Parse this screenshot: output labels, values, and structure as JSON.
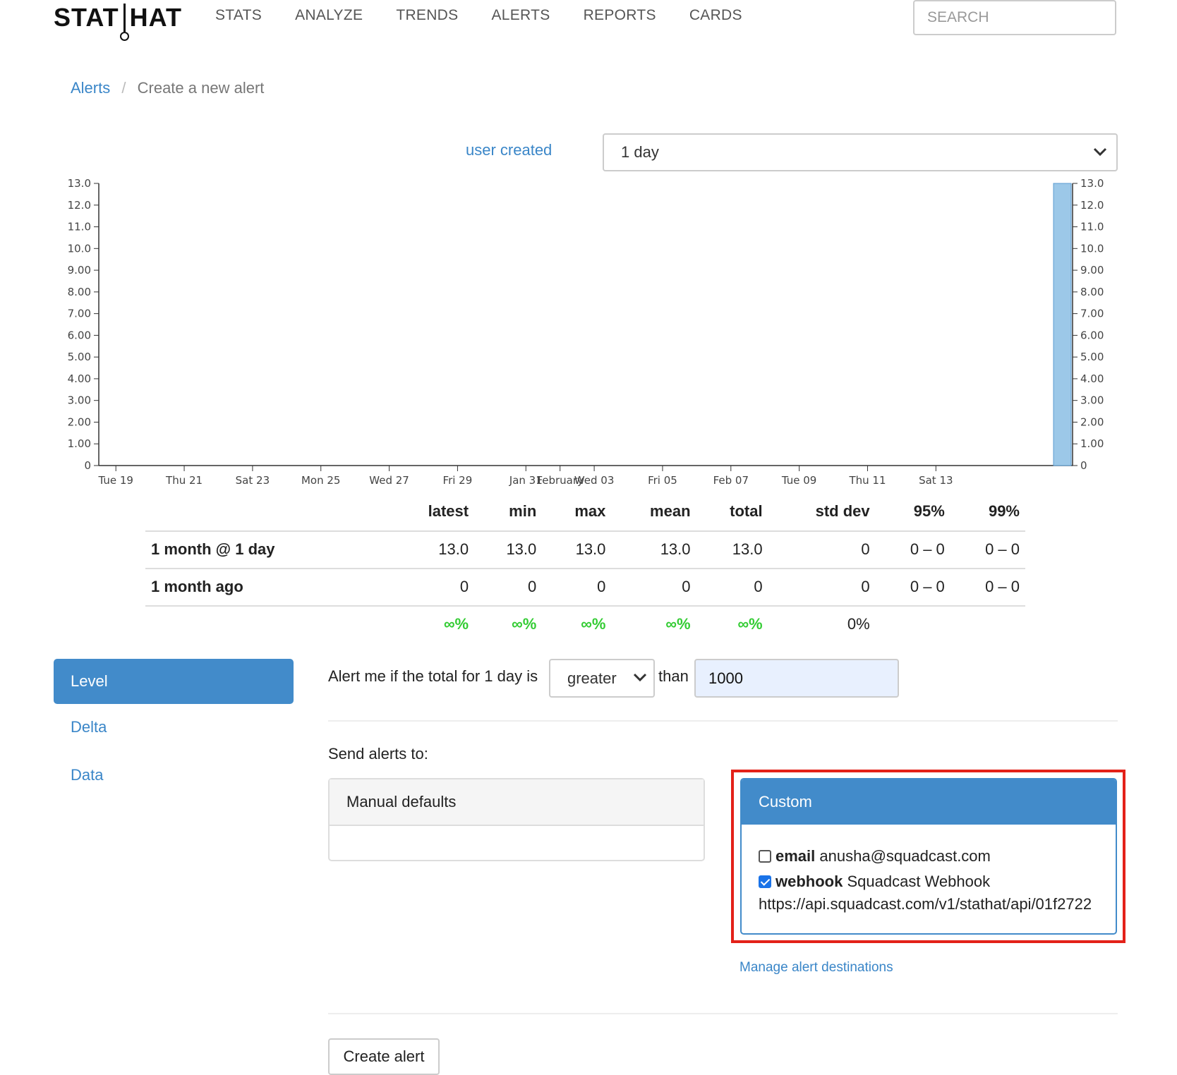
{
  "header": {
    "logo_left": "STAT",
    "logo_right": "HAT",
    "nav": [
      "STATS",
      "ANALYZE",
      "TRENDS",
      "ALERTS",
      "REPORTS",
      "CARDS"
    ],
    "search_placeholder": "SEARCH"
  },
  "breadcrumb": {
    "parent": "Alerts",
    "sep": "/",
    "current": "Create a new alert"
  },
  "stat_name": "user created",
  "range_select": "1 day",
  "chart_data": {
    "type": "bar",
    "y_ticks": [
      "0",
      "1.00",
      "2.00",
      "3.00",
      "4.00",
      "5.00",
      "6.00",
      "7.00",
      "8.00",
      "9.00",
      "10.0",
      "11.0",
      "12.0",
      "13.0"
    ],
    "ylim": [
      0,
      13
    ],
    "x_ticks": [
      "Tue 19",
      "Thu 21",
      "Sat 23",
      "Mon 25",
      "Wed 27",
      "Fri 29",
      "Jan 31",
      "February",
      "Wed 03",
      "Fri 05",
      "Feb 07",
      "Tue 09",
      "Thu 11",
      "Sat 13"
    ],
    "series": [
      {
        "x": "Feb 14",
        "y": 13.0
      }
    ],
    "bar_color": "#9cc8e8"
  },
  "stats_table": {
    "headers": [
      "",
      "latest",
      "min",
      "max",
      "mean",
      "total",
      "std dev",
      "95%",
      "99%"
    ],
    "rows": [
      [
        "1 month @ 1 day",
        "13.0",
        "13.0",
        "13.0",
        "13.0",
        "13.0",
        "0",
        "0 – 0",
        "0 – 0"
      ],
      [
        "1 month ago",
        "0",
        "0",
        "0",
        "0",
        "0",
        "0",
        "0 – 0",
        "0 – 0"
      ]
    ],
    "pct_row": [
      "",
      "∞%",
      "∞%",
      "∞%",
      "∞%",
      "∞%",
      "0%",
      "",
      ""
    ],
    "pct_color": "#3c3"
  },
  "tabs": {
    "level": "Level",
    "delta": "Delta",
    "data": "Data"
  },
  "rule": {
    "prefix": "Alert me if the total for 1 day is",
    "comparison": "greater",
    "than": "than",
    "threshold": "1000"
  },
  "send_to_label": "Send alerts to:",
  "manual_defaults": "Manual defaults",
  "custom": {
    "title": "Custom",
    "email": {
      "checked": false,
      "type": "email",
      "value": "anusha@squadcast.com"
    },
    "webhook": {
      "checked": true,
      "type": "webhook",
      "name": "Squadcast Webhook",
      "url": "https://api.squadcast.com/v1/stathat/api/01f2722"
    }
  },
  "manage_link": "Manage alert destinations",
  "create_button": "Create alert",
  "accent": "#428bca",
  "highlight_color": "#e32119"
}
